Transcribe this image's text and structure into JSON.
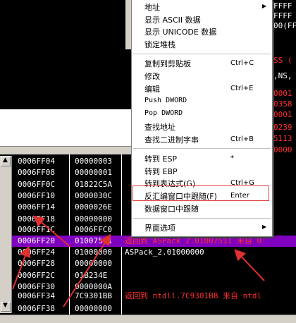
{
  "top_right": {
    "lines": [
      {
        "text": "FFFF",
        "red": false
      },
      {
        "text": "FFFF",
        "red": false
      },
      {
        "text": "00(FF",
        "red": false
      },
      {
        "text": "SS (",
        "red": true
      },
      {
        "text": ",NS,",
        "red": false
      },
      {
        "text": "0001",
        "red": true
      },
      {
        "text": "0358",
        "red": true
      },
      {
        "text": "0001",
        "red": true
      },
      {
        "text": "0239",
        "red": true
      },
      {
        "text": "5113",
        "red": true
      },
      {
        "text": "0000",
        "red": true
      }
    ]
  },
  "context_menu": {
    "items": [
      {
        "label": "地址",
        "key": "",
        "submenu": true
      },
      {
        "label": "显示 ASCII 数据",
        "key": "",
        "submenu": false
      },
      {
        "label": "显示 UNICODE 数据",
        "key": "",
        "submenu": false
      },
      {
        "label": "锁定堆栈",
        "key": "",
        "submenu": false
      },
      {
        "label": "复制到剪贴板",
        "key": "Ctrl+C",
        "submenu": false
      },
      {
        "label": "修改",
        "key": "",
        "submenu": false
      },
      {
        "label": "编辑",
        "key": "Ctrl+E",
        "submenu": false
      },
      {
        "label": "Push DWORD",
        "key": "",
        "submenu": false
      },
      {
        "label": "Pop DWORD",
        "key": "",
        "submenu": false
      },
      {
        "label": "查找地址",
        "key": "",
        "submenu": false
      },
      {
        "label": "查找二进制字串",
        "key": "Ctrl+B",
        "submenu": false
      },
      {
        "label": "转到 ESP",
        "key": "*",
        "submenu": false
      },
      {
        "label": "转到 EBP",
        "key": "",
        "submenu": false
      },
      {
        "label": "转到表达式(G)",
        "key": "Ctrl+G",
        "submenu": false
      },
      {
        "label": "反汇编窗口中跟随(F)",
        "key": "Enter",
        "submenu": false
      },
      {
        "label": "数据窗口中跟随",
        "key": "",
        "submenu": false
      },
      {
        "label": "界面选项",
        "key": "",
        "submenu": true
      }
    ]
  },
  "stack": {
    "rows": [
      {
        "addr": "0006FF04",
        "val": "00000003",
        "cmt": "",
        "hl": false,
        "red": false
      },
      {
        "addr": "0006FF08",
        "val": "00000001",
        "cmt": "",
        "hl": false,
        "red": false
      },
      {
        "addr": "0006FF0C",
        "val": "01822C5A",
        "cmt": "",
        "hl": false,
        "red": false
      },
      {
        "addr": "0006FF10",
        "val": "0000030C",
        "cmt": "",
        "hl": false,
        "red": false
      },
      {
        "addr": "0006FF14",
        "val": "0000026E",
        "cmt": "",
        "hl": false,
        "red": false
      },
      {
        "addr": "0006FF18",
        "val": "00000000",
        "cmt": "",
        "hl": false,
        "red": false
      },
      {
        "addr": "0006FF1C",
        "val": "0006FFC0",
        "cmt": "",
        "hl": false,
        "red": false
      },
      {
        "addr": "0006FF20",
        "val": "01007511",
        "cmt": "返回到 ASPack_2.01007511 来自 0",
        "hl": true,
        "red": true
      },
      {
        "addr": "0006FF24",
        "val": "01000000",
        "cmt": "ASPack_2.01000000",
        "hl": false,
        "red": false
      },
      {
        "addr": "0006FF28",
        "val": "00000000",
        "cmt": "",
        "hl": false,
        "red": false
      },
      {
        "addr": "0006FF2C",
        "val": "01B234E",
        "cmt": "",
        "hl": false,
        "red": false
      },
      {
        "addr": "0006FF30",
        "val": "0000000A",
        "cmt": "",
        "hl": false,
        "red": false
      },
      {
        "addr": "0006FF34",
        "val": "7C9301BB",
        "cmt": "返回到 ntdll.7C9301BB 来自 ntdl",
        "hl": false,
        "red": true
      },
      {
        "addr": "0006FF38",
        "val": "00000000",
        "cmt": "",
        "hl": false,
        "red": false
      }
    ]
  },
  "colors": {
    "highlight_row": "#8000c0",
    "annotation_red": "#e03030",
    "menu_highlight_border": "#e04040"
  }
}
